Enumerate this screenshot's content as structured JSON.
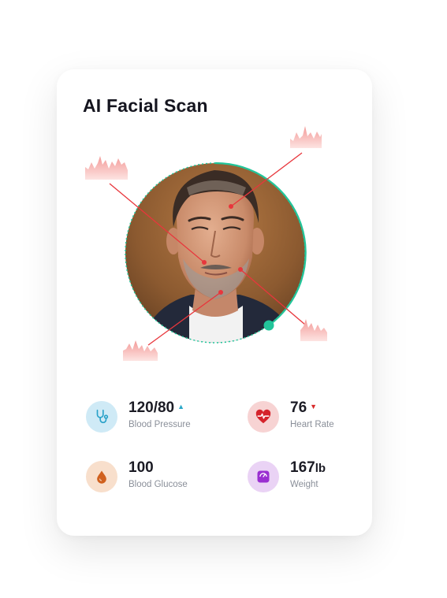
{
  "card": {
    "title": "AI Facial Scan"
  },
  "colors": {
    "accent_ring": "#22c59a",
    "scan_line": "#e8363c",
    "pulse_wave": "#f7b9b7"
  },
  "metrics": [
    {
      "value": "120/80",
      "unit": "",
      "label": "Blood Pressure",
      "trend": "▲",
      "icon": "stethoscope-icon"
    },
    {
      "value": "76",
      "unit": "",
      "label": "Heart Rate",
      "trend": "▼",
      "icon": "heart-pulse-icon"
    },
    {
      "value": "100",
      "unit": "",
      "label": "Blood Glucose",
      "trend": "",
      "icon": "blood-drop-icon"
    },
    {
      "value": "167",
      "unit": "lb",
      "label": "Weight",
      "trend": "",
      "icon": "weight-scale-icon"
    }
  ]
}
